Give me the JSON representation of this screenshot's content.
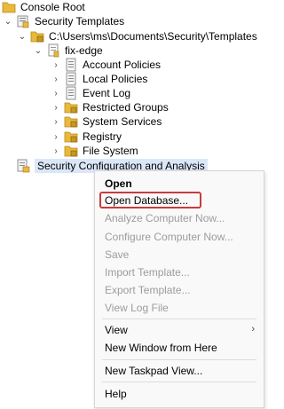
{
  "tree": {
    "items": [
      {
        "label": "Console Root",
        "icon": "folder-icon"
      },
      {
        "label": "Security Templates",
        "icon": "security-templates-icon"
      },
      {
        "label": "C:\\Users\\ms\\Documents\\Security\\Templates",
        "icon": "lock-folder-icon"
      },
      {
        "label": "fix-edge",
        "icon": "template-icon"
      },
      {
        "label": "Account Policies",
        "icon": "policy-icon"
      },
      {
        "label": "Local Policies",
        "icon": "policy-icon"
      },
      {
        "label": "Event Log",
        "icon": "policy-icon"
      },
      {
        "label": "Restricted Groups",
        "icon": "lock-folder-icon"
      },
      {
        "label": "System Services",
        "icon": "lock-folder-icon"
      },
      {
        "label": "Registry",
        "icon": "lock-folder-icon"
      },
      {
        "label": "File System",
        "icon": "lock-folder-icon"
      },
      {
        "label": "Security Configuration and Analysis",
        "icon": "security-config-icon"
      }
    ]
  },
  "context_menu": {
    "items": [
      {
        "label": "Open",
        "enabled": true,
        "bold": true
      },
      {
        "label": "Open Database...",
        "enabled": true,
        "highlighted": true
      },
      {
        "label": "Analyze Computer Now...",
        "enabled": false
      },
      {
        "label": "Configure Computer Now...",
        "enabled": false
      },
      {
        "label": "Save",
        "enabled": false
      },
      {
        "label": "Import Template...",
        "enabled": false
      },
      {
        "label": "Export Template...",
        "enabled": false
      },
      {
        "label": "View Log File",
        "enabled": false
      },
      {
        "label": "View",
        "enabled": true,
        "submenu": true
      },
      {
        "label": "New Window from Here",
        "enabled": true
      },
      {
        "label": "New Taskpad View...",
        "enabled": true
      },
      {
        "label": "Help",
        "enabled": true
      }
    ]
  },
  "colors": {
    "highlight_border": "#c93b3b",
    "selection_bg": "#dbe7f7",
    "disabled_text": "#9c9c9c",
    "folder": "#e8b93c"
  }
}
